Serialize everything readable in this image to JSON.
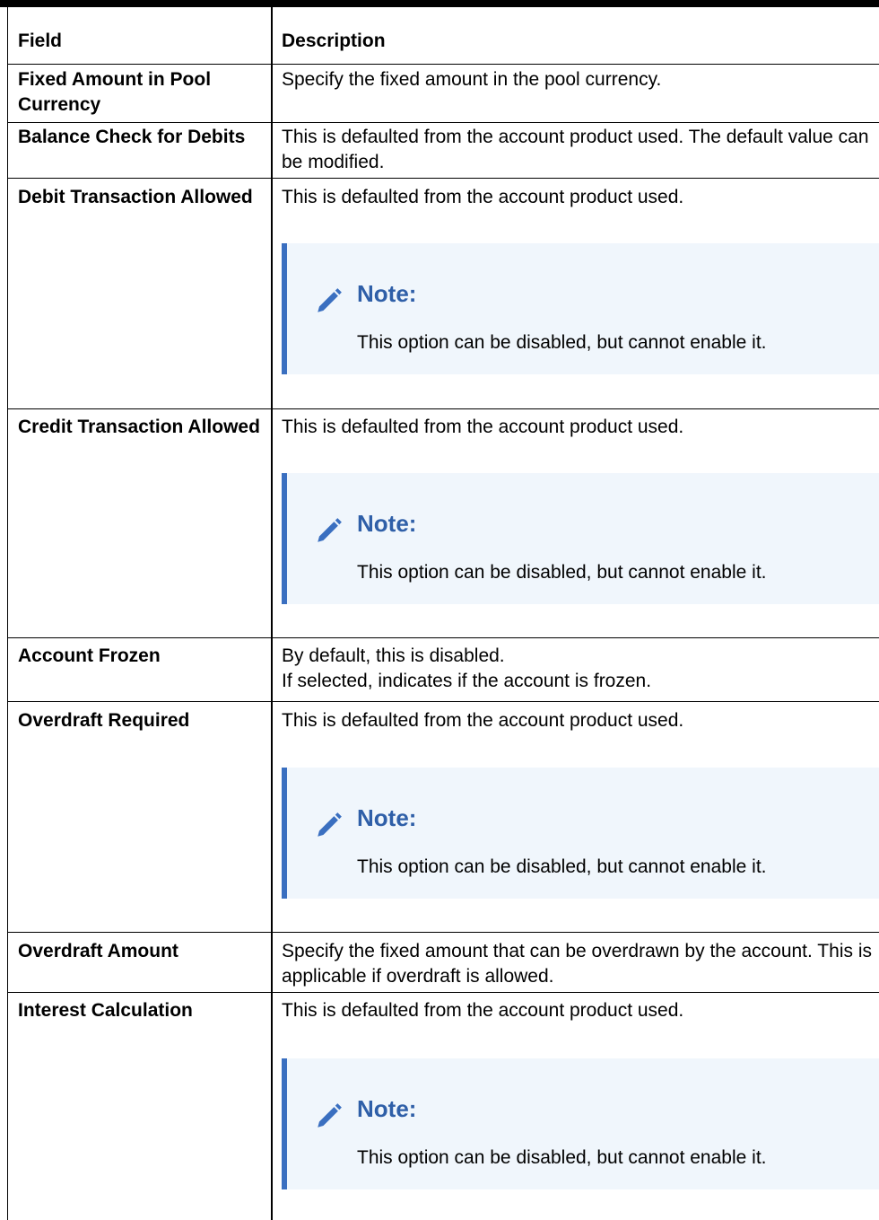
{
  "header": {
    "field": "Field",
    "description": "Description"
  },
  "rows": [
    {
      "field": "Fixed Amount in Pool Currency",
      "description": "Specify the fixed amount in the pool currency."
    },
    {
      "field": "Balance Check for Debits",
      "description": "This is defaulted from the account product used. The default value can be modified."
    },
    {
      "field": "Debit Transaction Allowed",
      "description": "This is defaulted from the account product used.",
      "note_label": "Note:",
      "note_text": "This option can be disabled, but cannot enable it."
    },
    {
      "field": "Credit Transaction Allowed",
      "description": "This is defaulted from the account product used.",
      "note_label": "Note:",
      "note_text": "This option can be disabled, but cannot enable it."
    },
    {
      "field": "Account Frozen",
      "description_line1": "By default, this is disabled.",
      "description_line2": "If selected, indicates if the account is frozen."
    },
    {
      "field": "Overdraft Required",
      "description": "This is defaulted from the account product used.",
      "note_label": "Note:",
      "note_text": "This option can be disabled, but cannot enable it."
    },
    {
      "field": "Overdraft Amount",
      "description": "Specify the fixed amount that can be overdrawn by the account. This is applicable if overdraft is allowed."
    },
    {
      "field": "Interest Calculation",
      "description": "This is defaulted from the account product used.",
      "note_label": "Note:",
      "note_text": "This option can be disabled, but cannot enable it."
    }
  ],
  "note_icon": "pencil-icon",
  "colors": {
    "note_bg": "#f0f6fc",
    "note_accent": "#3a6fc0",
    "note_label": "#2f5fa8"
  }
}
